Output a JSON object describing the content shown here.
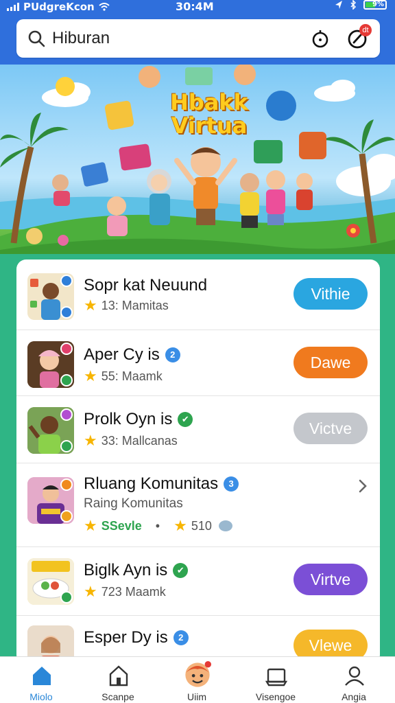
{
  "status_bar": {
    "carrier": "PUdgreKcon",
    "time": "30:4M",
    "battery": "9%"
  },
  "search": {
    "query": "Hiburan",
    "notification_badge": "dt"
  },
  "banner": {
    "title": "Hbakk Virtua"
  },
  "list": [
    {
      "title": "Sopr kat Neuund",
      "meta": "13: Mamitas",
      "badge": "",
      "action": "Vithie",
      "action_color": "#2aa6e0"
    },
    {
      "title": "Aper Cy is",
      "meta": "55: Maamk",
      "badge": "2",
      "action": "Dawe",
      "action_color": "#f07a1e"
    },
    {
      "title": "Prolk Oyn is",
      "meta": "33: Mallcanas",
      "badge": "verified",
      "action": "Victve",
      "action_color": "#c4c7cc"
    },
    {
      "title": "Rluang Komunitas",
      "subtitle": "Raing Komunitas",
      "meta_left": "SSevle",
      "meta_right": "510",
      "badge": "3"
    },
    {
      "title": "Biglk Ayn is",
      "meta": "723 Maamk",
      "badge": "verified",
      "action": "Virtve",
      "action_color": "#7b4fd6"
    },
    {
      "title": "Esper Dy is",
      "meta": "",
      "badge": "2",
      "action": "Vlewe",
      "action_color": "#f5b82a"
    }
  ],
  "bottom_nav": [
    {
      "label": "Miolo",
      "icon": "home-icon",
      "active": true
    },
    {
      "label": "Scanpe",
      "icon": "store-icon",
      "active": false
    },
    {
      "label": "Uiim",
      "icon": "avatar-icon",
      "active": false
    },
    {
      "label": "Visengoe",
      "icon": "folder-icon",
      "active": false
    },
    {
      "label": "Angia",
      "icon": "profile-icon",
      "active": false
    }
  ],
  "colors": {
    "header": "#2f6fdc",
    "sheet_bg": "#2fb585",
    "active_tab": "#2a87d8"
  }
}
